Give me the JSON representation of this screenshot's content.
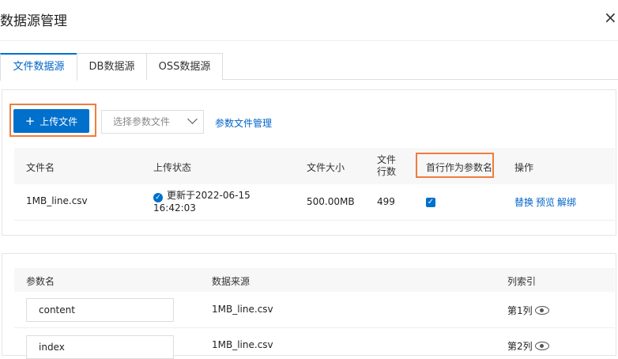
{
  "dialog": {
    "title": "数据源管理",
    "close": "×"
  },
  "tabs": [
    {
      "label": "文件数据源",
      "active": true
    },
    {
      "label": "DB数据源"
    },
    {
      "label": "OSS数据源"
    }
  ],
  "toolbar": {
    "upload_label": "上传文件",
    "upload_icon": "+",
    "select_placeholder": "选择参数文件",
    "param_file_link": "参数文件管理"
  },
  "file_table": {
    "headers": {
      "name": "文件名",
      "status": "上传状态",
      "size": "文件大小",
      "rows_line1": "文件",
      "rows_line2": "行数",
      "first_row": "首行作为参数名",
      "actions": "操作"
    },
    "rows": [
      {
        "name": "1MB_line.csv",
        "status_line1": "更新于2022-06-15",
        "status_line2": "16:42:03",
        "size": "500.00MB",
        "rows": "499",
        "first_row_checked": true,
        "actions": [
          "替换",
          "预览",
          "解绑"
        ]
      }
    ]
  },
  "param_table": {
    "headers": {
      "name": "参数名",
      "source": "数据来源",
      "column": "列索引"
    },
    "rows": [
      {
        "name": "content",
        "source": "1MB_line.csv",
        "column": "第1列"
      },
      {
        "name": "index",
        "source": "1MB_line.csv",
        "column": "第2列"
      }
    ]
  },
  "colors": {
    "accent": "#0070cc",
    "highlight": "#f07c3c"
  }
}
